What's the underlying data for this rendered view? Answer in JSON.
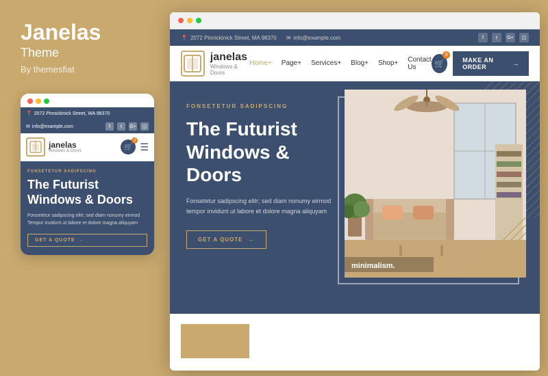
{
  "left": {
    "brand_name": "Janelas",
    "brand_theme": "Theme",
    "brand_by": "By themesfiat"
  },
  "mobile": {
    "address": "2072 Pinnickinick Street, WA 98370",
    "email": "info@example.com",
    "section_label": "FONSETETUR SADIPSCING",
    "hero_title_line1": "The Futurist",
    "hero_title_line2": "Windows & Doors",
    "hero_desc": "Fonsetetur sadipscing elitr; sed diam nonumy eirmod Tempor invidunt ut labore et dolore magna aliquyam",
    "cta_label": "GET A QUOTE",
    "logo_text": "janelas",
    "logo_sub": "Windows & Doors",
    "cart_badge": "0"
  },
  "desktop": {
    "address": "2072 Pinnickinick Street, MA 98370",
    "email": "info@example.com",
    "logo_text": "janelas",
    "logo_sub": "Windows & Doors",
    "nav": {
      "home": "Home+",
      "page": "Page+",
      "services": "Services+",
      "blog": "Blog+",
      "shop": "Shop+",
      "contact": "Contact Us"
    },
    "cta_button": "MAKE AN ORDER",
    "cart_badge": "0",
    "section_label": "FONSETETUR SADIPSCING",
    "hero_title_line1": "The Futurist",
    "hero_title_line2": "Windows & Doors",
    "hero_desc": "Fonsetetur sadipscing elitr; sed diam nonumy eirmod tempor invidunt ut labore et dolore magna aliquyam",
    "cta_label": "GET A QUOTE",
    "minimalism_label": "minimalism.",
    "arrow": "→"
  }
}
